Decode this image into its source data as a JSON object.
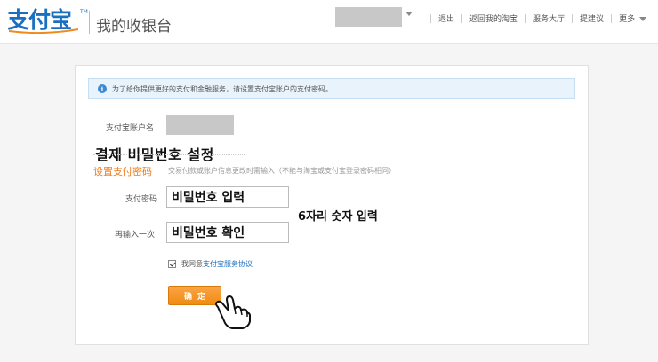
{
  "header": {
    "logo_text": "支付宝",
    "logo_tm": "TM",
    "page_title": "我的收银台",
    "nav": [
      {
        "label": "退出"
      },
      {
        "label": "返回我的淘宝"
      },
      {
        "label": "服务大厅"
      },
      {
        "label": "提建议"
      },
      {
        "label": "更多"
      }
    ]
  },
  "notice": {
    "icon": "info-icon",
    "icon_glyph": "i",
    "text": "为了给你提供更好的支付和金融服务，请设置支付宝账户的支付密码。"
  },
  "form": {
    "account_label": "支付宝账户名",
    "annotation_title": "결제 비밀번호 설정",
    "section_title": "设置支付密码",
    "section_hint": "交易付款或账户信息更改时需输入（不能与淘宝或支付宝登录密码相同）",
    "password_label": "支付密码",
    "password_value": "비밀번호 입력",
    "confirm_label": "再输入一次",
    "confirm_value": "비밀번호 확인",
    "annotation_hint": "6자리 숫자 입력",
    "agree_prefix": "我同意",
    "agree_link": "支付宝服务协议",
    "submit_label": "确定"
  },
  "colors": {
    "brand_blue": "#1a6fbf",
    "accent_orange": "#f07a1a",
    "notice_bg": "#e8f3fb"
  }
}
